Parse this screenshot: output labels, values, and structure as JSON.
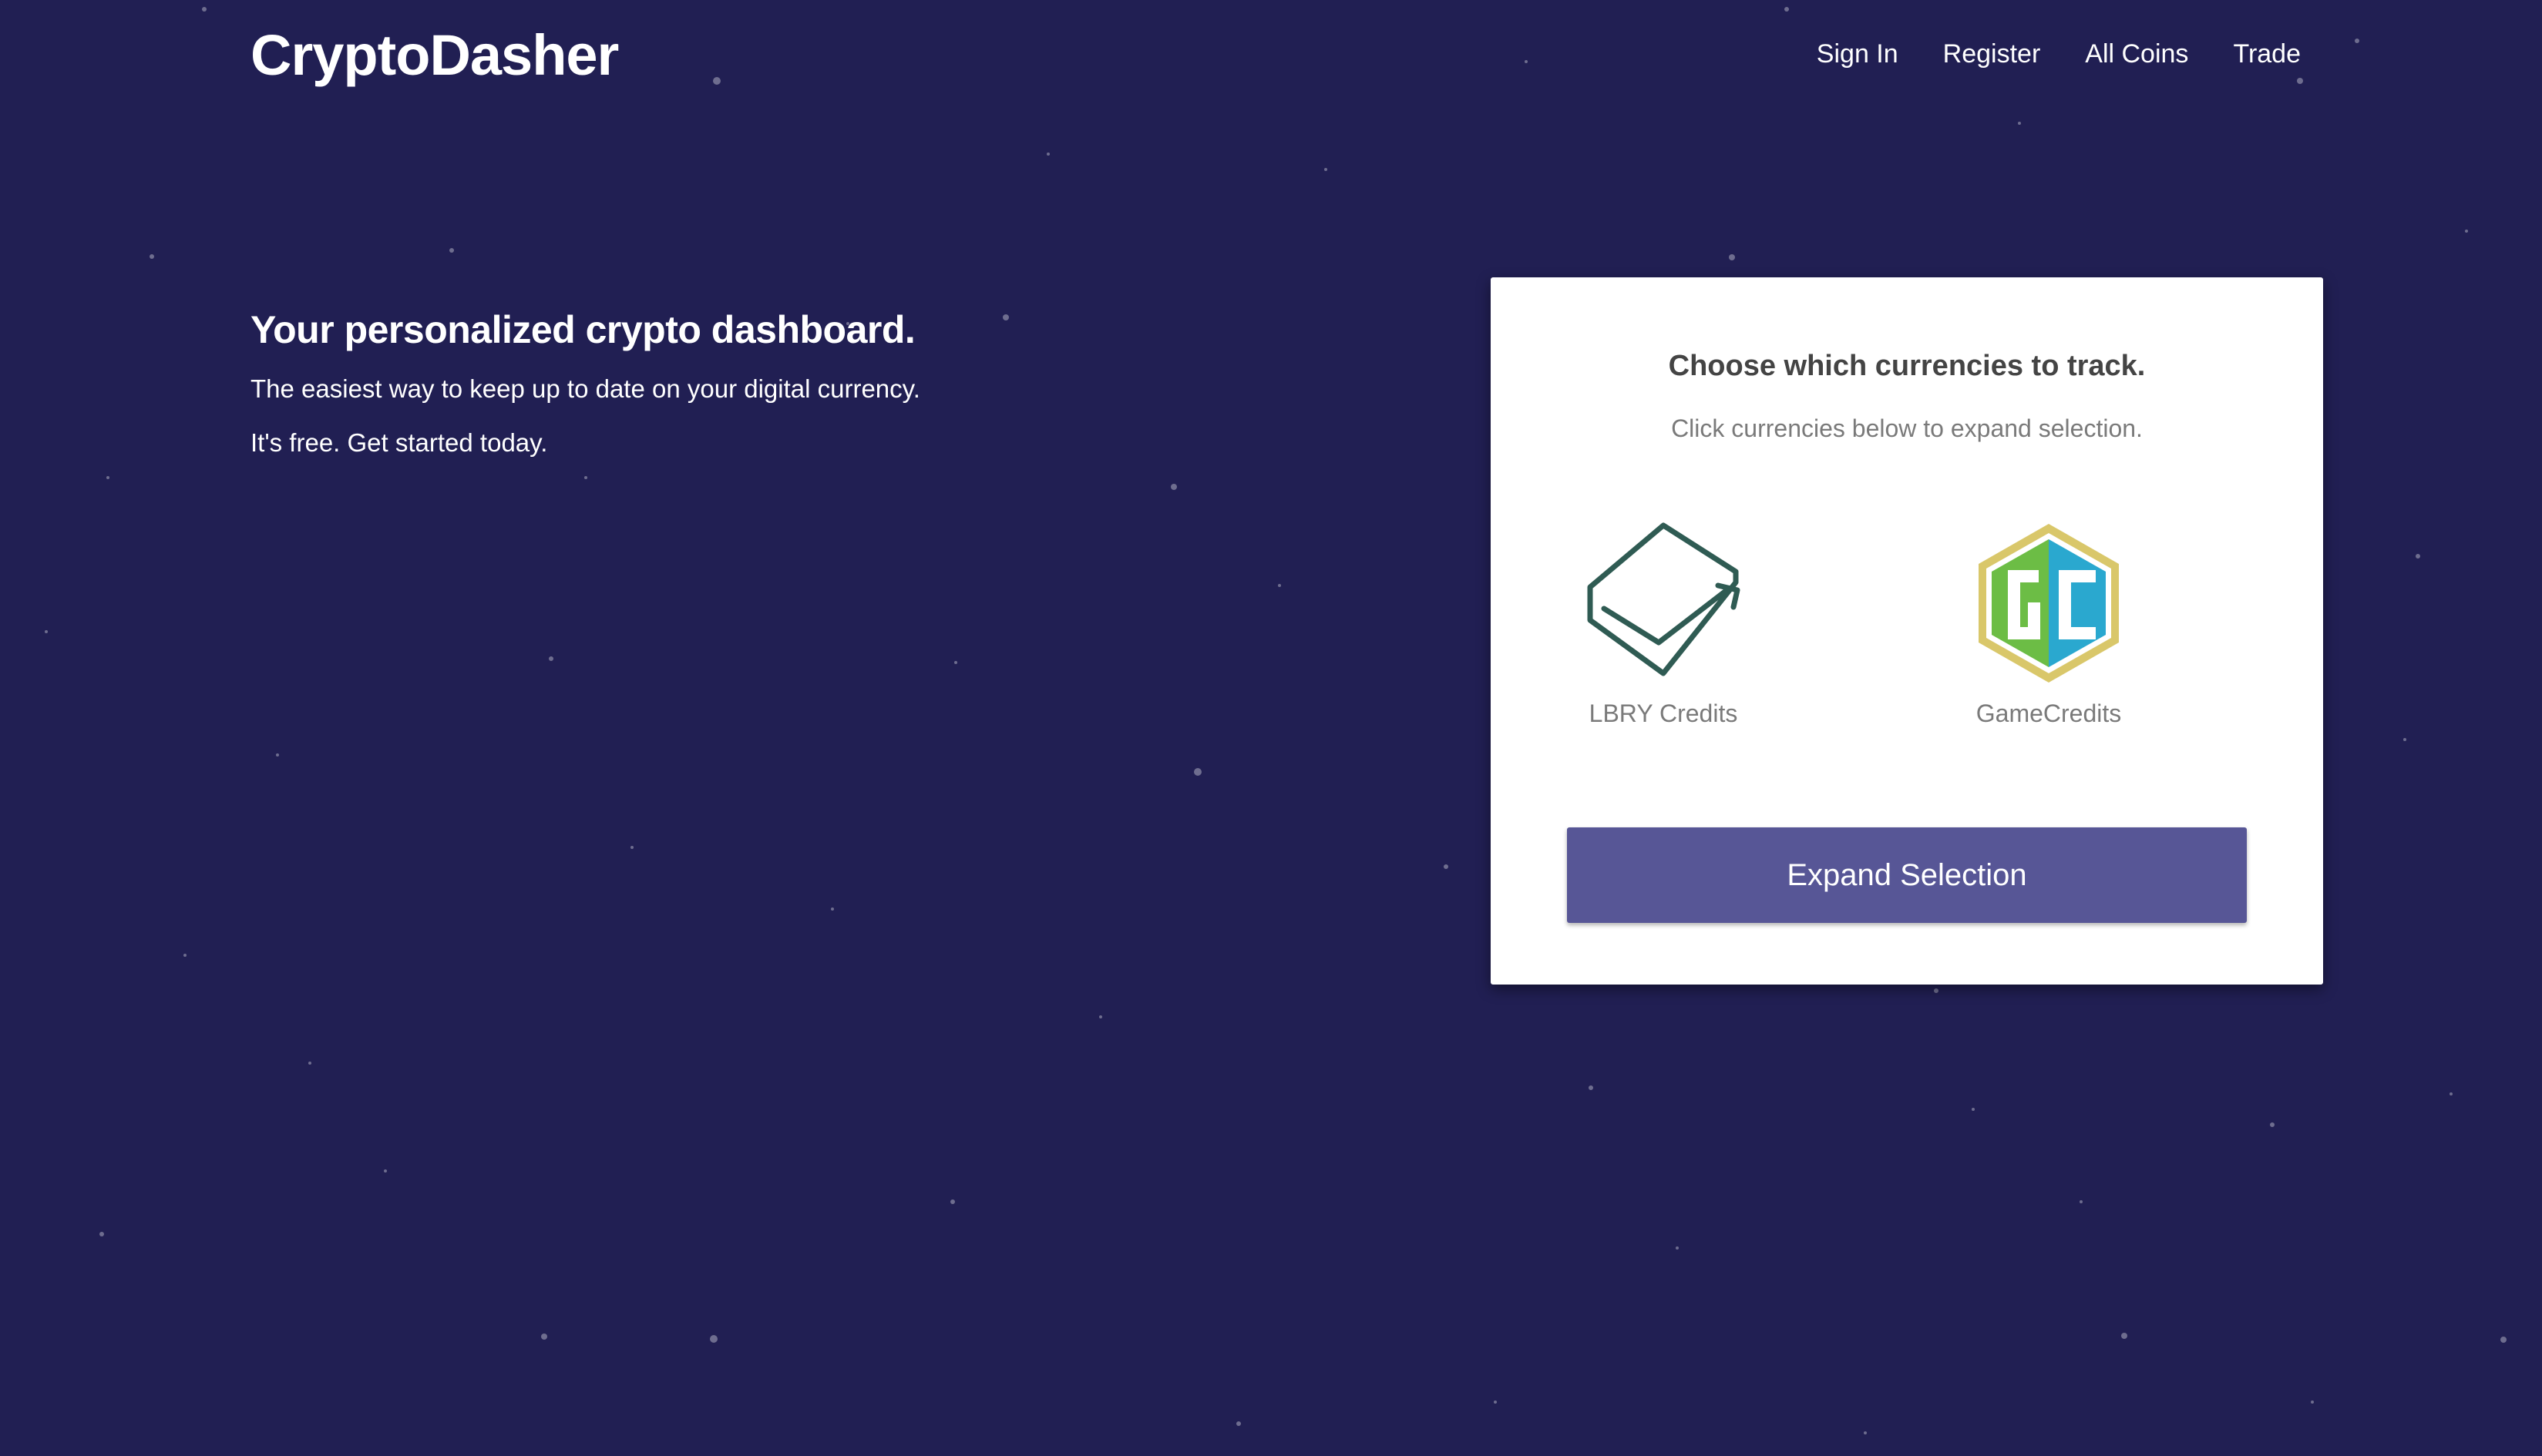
{
  "header": {
    "brand": "CryptoDasher",
    "nav": [
      "Sign In",
      "Register",
      "All Coins",
      "Trade"
    ]
  },
  "hero": {
    "heading": "Your personalized crypto dashboard.",
    "line1": "The easiest way to keep up to date on your digital currency.",
    "line2": "It's free. Get started today."
  },
  "card": {
    "title": "Choose which currencies to track.",
    "subtitle": "Click currencies below to expand selection.",
    "coins": [
      {
        "name": "LBRY Credits",
        "icon": "lbry-credits-icon",
        "color": "#2f5b53"
      },
      {
        "name": "GameCredits",
        "icon": "gamecredits-icon",
        "colors": [
          "#d9c76a",
          "#6cbd45",
          "#2aa8cf"
        ]
      }
    ],
    "button": "Expand Selection"
  },
  "colors": {
    "background": "#211f53",
    "button": "#575696",
    "card": "#ffffff"
  }
}
